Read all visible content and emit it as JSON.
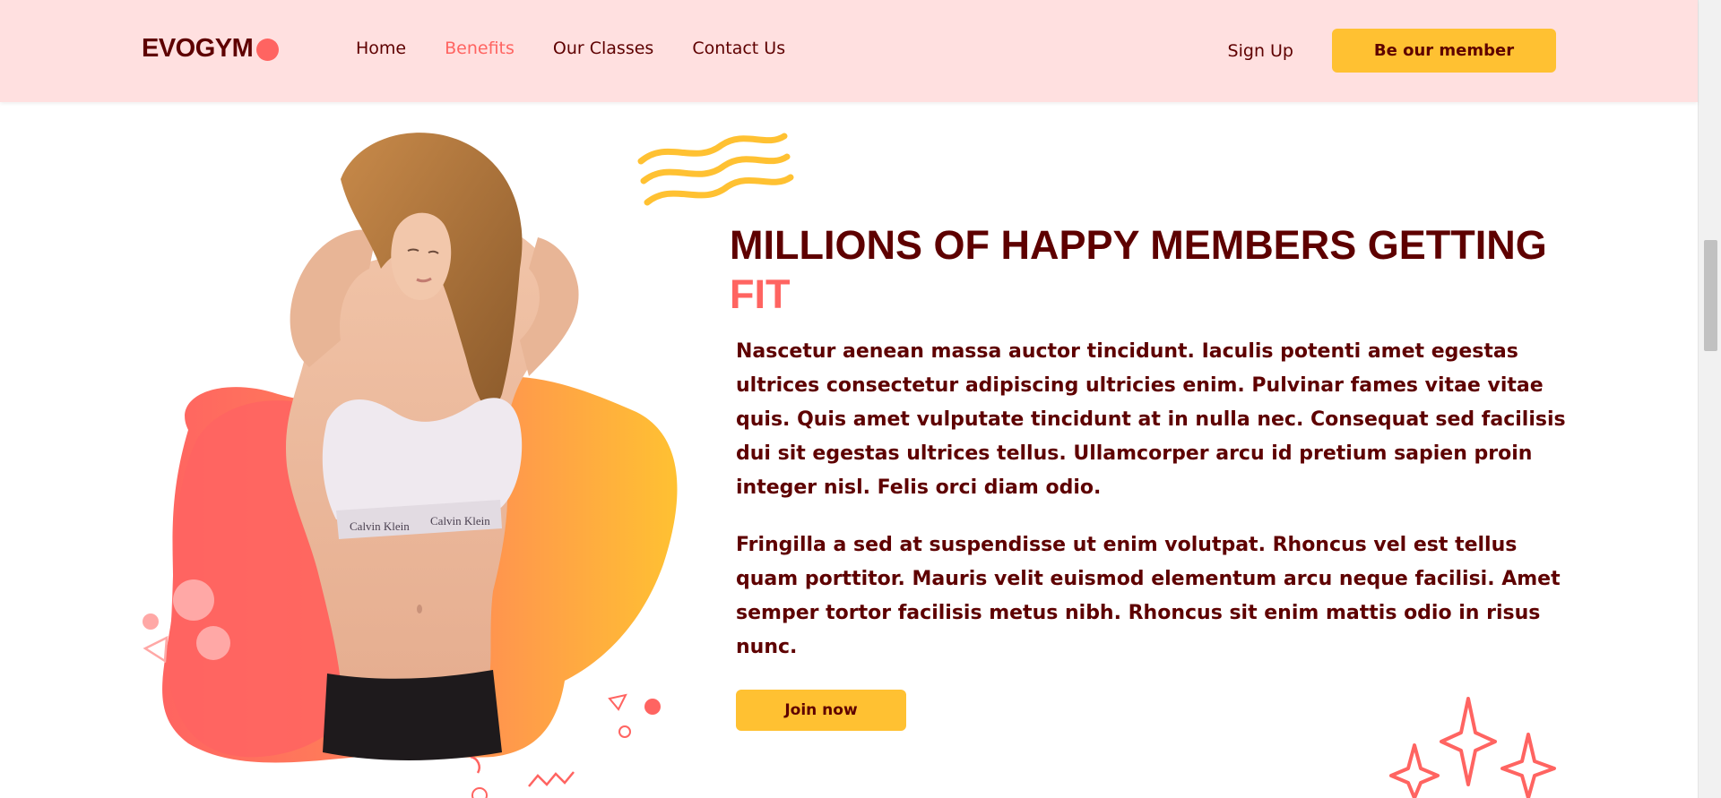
{
  "nav": {
    "logo": "EVOGYM",
    "links": [
      "Home",
      "Benefits",
      "Our Classes",
      "Contact Us"
    ],
    "active_link": "Benefits",
    "sign_up": "Sign Up",
    "member_button": "Be our member"
  },
  "hero": {
    "headline": "MILLIONS OF HAPPY MEMBERS GETTING",
    "headline_accent": "FIT",
    "paragraph1": "Nascetur aenean massa auctor tincidunt. Iaculis potenti amet egestas ultrices consectetur adipiscing ultricies enim. Pulvinar fames vitae vitae quis. Quis amet vulputate tincidunt at in nulla nec. Consequat sed facilisis dui sit egestas ultrices tellus. Ullamcorper arcu id pretium sapien proin integer nisl. Felis orci diam odio.",
    "paragraph2": "Fringilla a sed at suspendisse ut enim volutpat. Rhoncus vel est tellus quam porttitor. Mauris velit euismod elementum arcu neque facilisi. Amet semper tortor facilisis metus nibh. Rhoncus sit enim mattis odio in risus nunc.",
    "join_button": "Join now",
    "image_brand_text": "Calvin Klein"
  },
  "colors": {
    "primary": "#ffc132",
    "secondary": "#ff6461",
    "text": "#5e0000",
    "nav_bg": "#ffe0e0"
  },
  "icons": [
    "logo-dot-icon",
    "waves-icon",
    "sparkles-icon",
    "confetti-icon"
  ]
}
